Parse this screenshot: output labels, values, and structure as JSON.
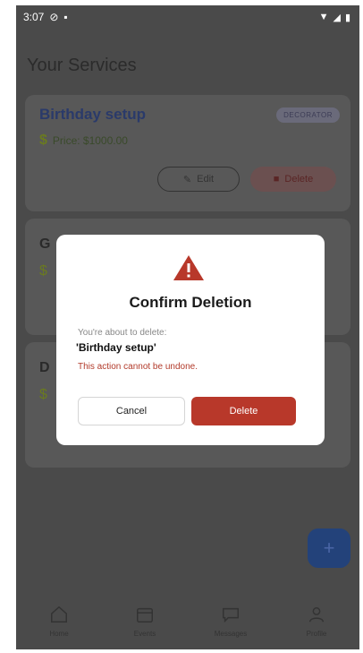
{
  "status": {
    "time": "3:07"
  },
  "page": {
    "title": "Your Services"
  },
  "services": [
    {
      "title": "Birthday setup",
      "badge": "DECORATOR",
      "price": "Price: $1000.00",
      "edit_label": "Edit",
      "delete_label": "Delete"
    },
    {
      "title": "G",
      "badge": ""
    },
    {
      "title": "D",
      "badge": ""
    }
  ],
  "dialog": {
    "title": "Confirm Deletion",
    "subtitle": "You're about to delete:",
    "item_name": "'Birthday setup'",
    "warning": "This action cannot be undone.",
    "cancel_label": "Cancel",
    "delete_label": "Delete"
  },
  "nav": [
    {
      "label": "Home"
    },
    {
      "label": "Events"
    },
    {
      "label": "Messages"
    },
    {
      "label": "Profile"
    }
  ],
  "colors": {
    "danger": "#b8382a",
    "primary": "#23427a"
  }
}
